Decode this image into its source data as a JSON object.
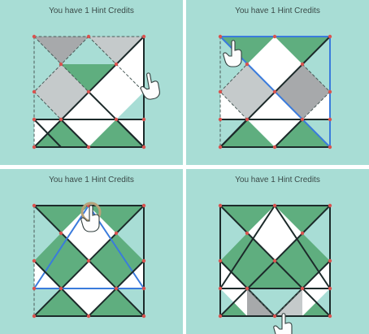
{
  "hint_text": "You have 1 Hint Credits",
  "colors": {
    "background": "#a8ddd5",
    "green": "#5fae7f",
    "gray": "#a7a9ab",
    "light_gray": "#c5cacb",
    "white": "#ffffff",
    "line": "#1c2a2a",
    "node": "#d9534f",
    "highlight": "#3a7bdc",
    "hint_ring": "#b8a27a"
  },
  "panels": [
    {
      "id": "p0",
      "hand_icon": "pointing-hand-icon"
    },
    {
      "id": "p1",
      "hand_icon": "pointing-hand-icon"
    },
    {
      "id": "p2",
      "hand_icon": "pointing-hand-icon"
    },
    {
      "id": "p3",
      "hand_icon": "pointing-hand-icon"
    }
  ]
}
